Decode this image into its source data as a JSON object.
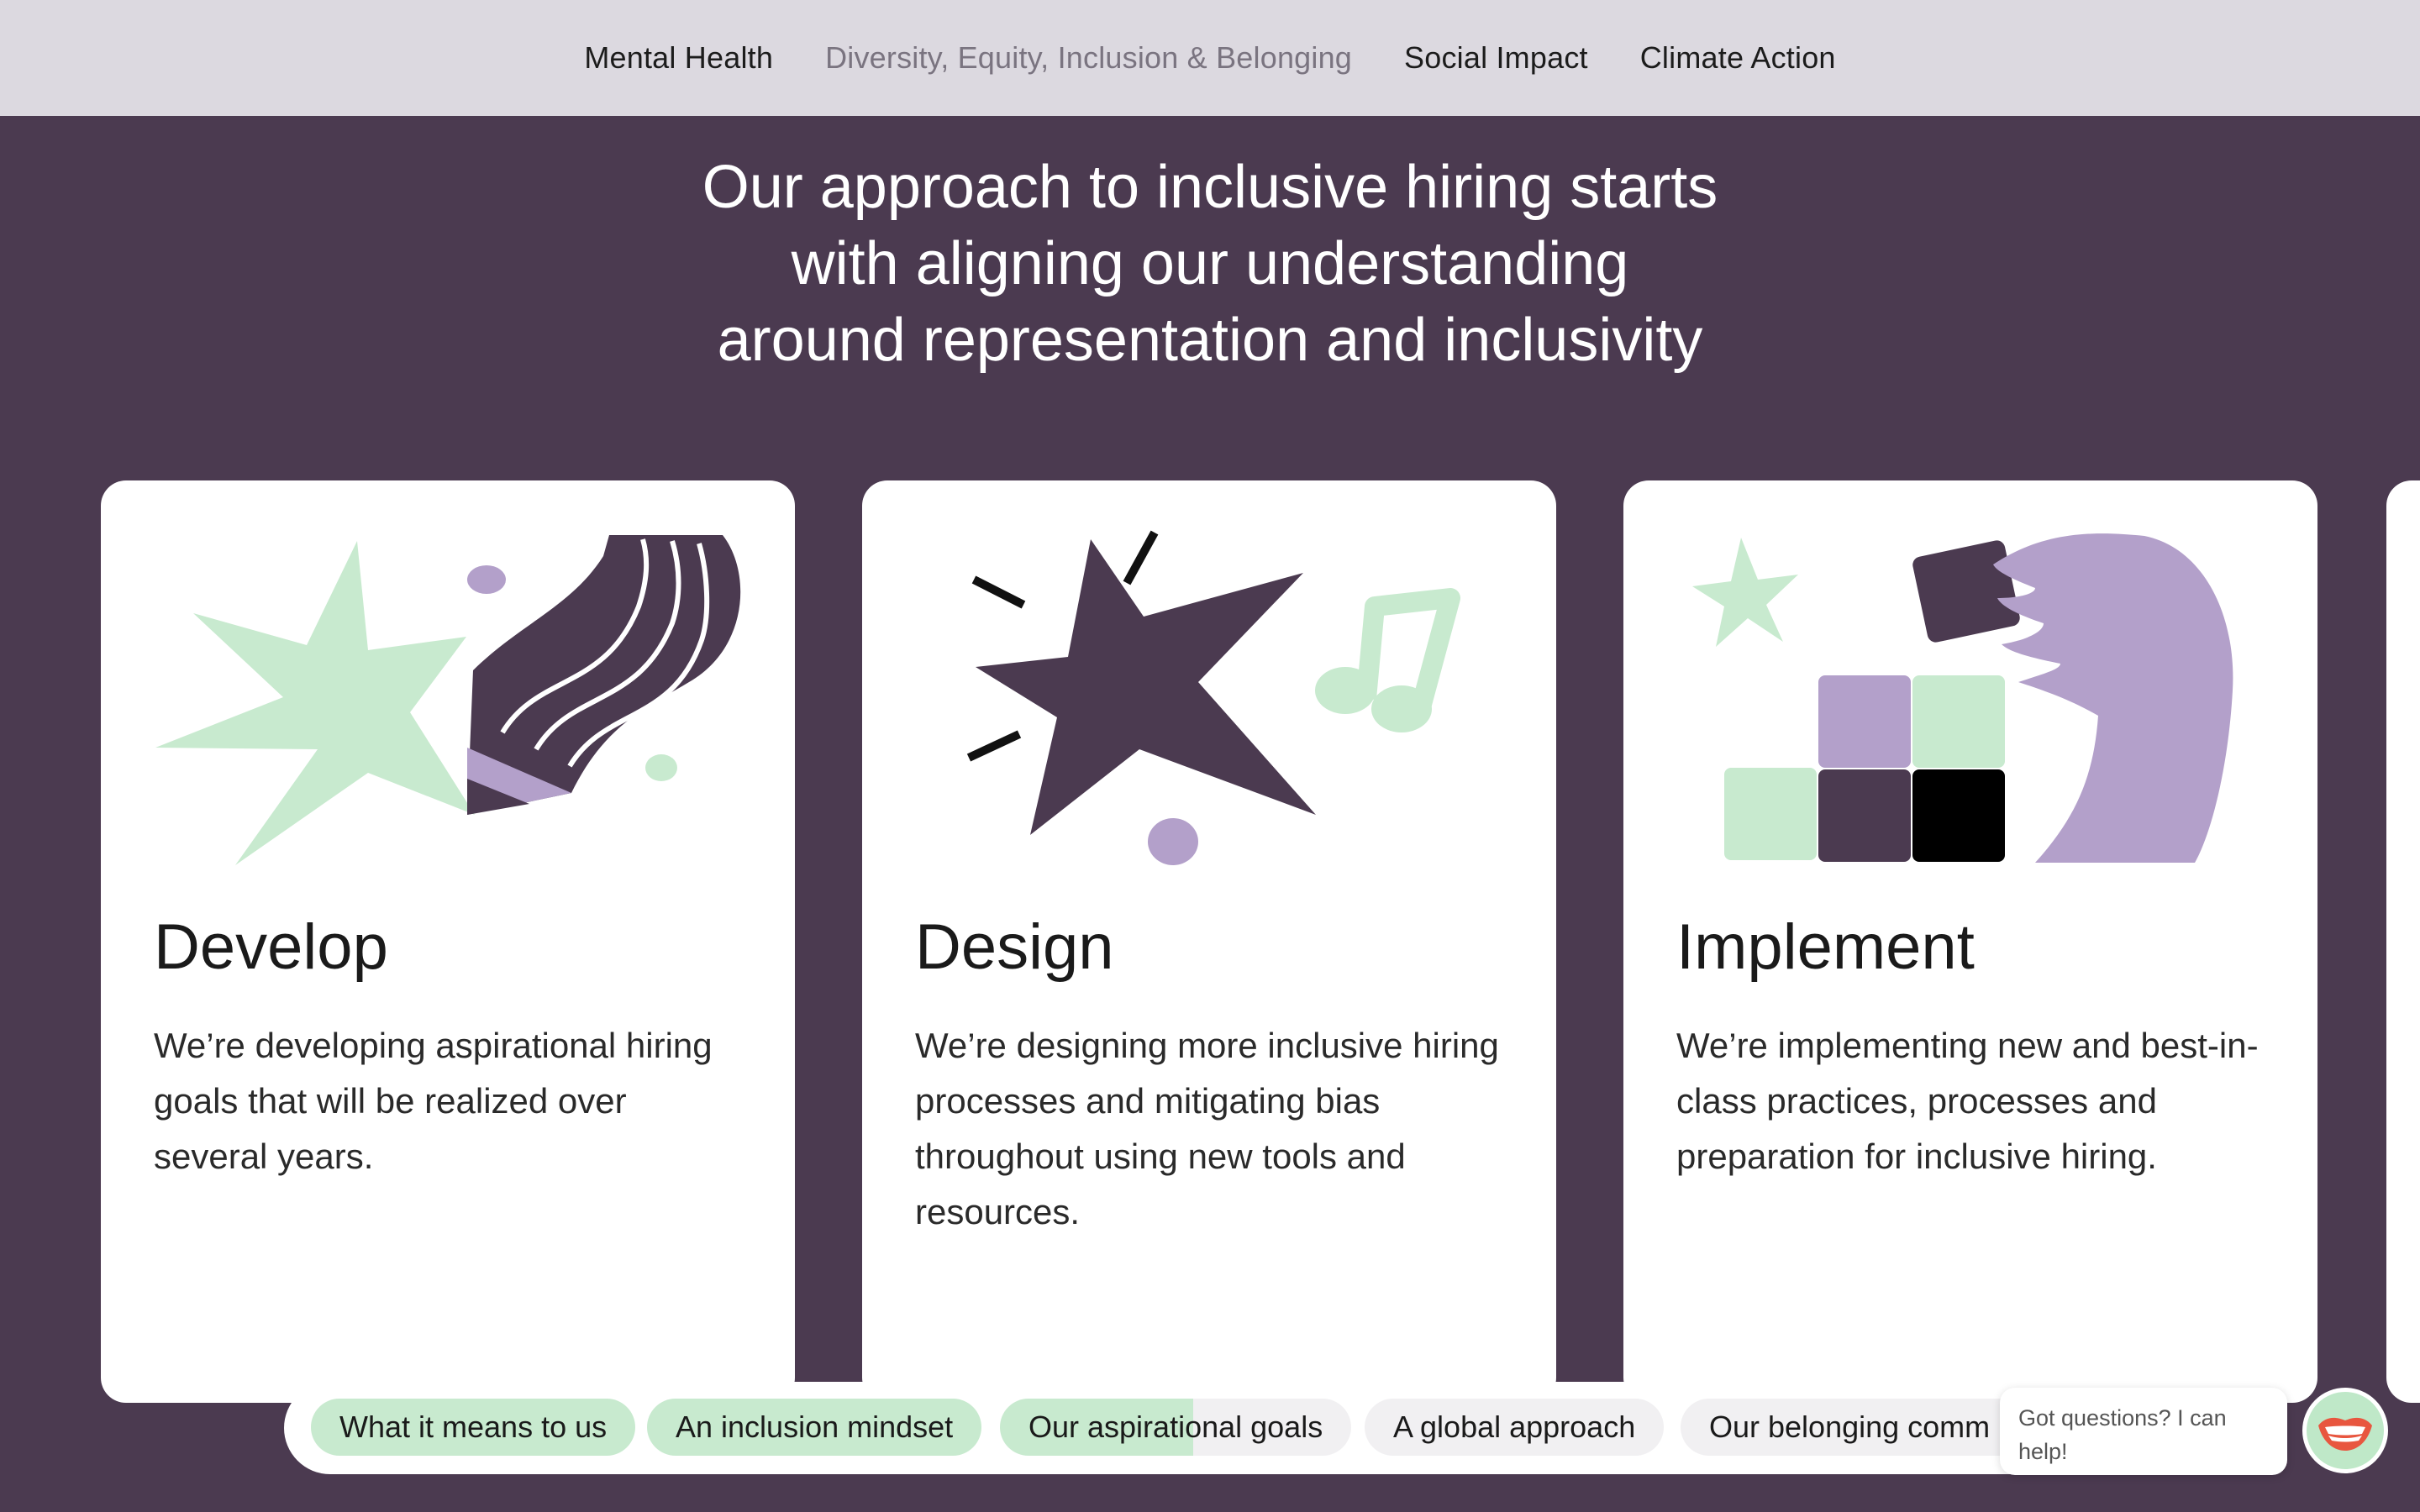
{
  "topnav": {
    "items": [
      {
        "label": "Mental Health"
      },
      {
        "label": "Diversity, Equity, Inclusion & Belonging"
      },
      {
        "label": "Social Impact"
      },
      {
        "label": "Climate Action"
      }
    ]
  },
  "hero": {
    "lines": [
      "Our approach to inclusive hiring starts",
      "with aligning our understanding",
      "around representation and inclusivity"
    ]
  },
  "cards": [
    {
      "title": "Develop",
      "description": "We’re developing aspirational hiring goals that will be realized over several years.",
      "icon": "star-pencil-illustration"
    },
    {
      "title": "Design",
      "description": "We’re designing more inclusive hiring processes and mitigating bias throughout using new tools and resources.",
      "icon": "star-music-note-illustration"
    },
    {
      "title": "Implement",
      "description": "We’re implementing new and best-in-class practices, processes and preparation for inclusive hiring.",
      "icon": "building-blocks-hand-illustration"
    }
  ],
  "subnav": {
    "items": [
      {
        "label": "What it means to us",
        "state": "done"
      },
      {
        "label": "An inclusion mindset",
        "state": "done"
      },
      {
        "label": "Our aspirational goals",
        "state": "current"
      },
      {
        "label": "A global approach",
        "state": "upcoming"
      },
      {
        "label": "Our belonging comm",
        "state": "upcoming"
      }
    ]
  },
  "chat": {
    "text": "Got questions? I can help!",
    "avatar_icon": "smiling-mouth-icon"
  },
  "colors": {
    "background": "#4b3a50",
    "topnav": "#dcd9e0",
    "mint": "#c8eacf",
    "lavender": "#b3a0ca",
    "plum": "#4b3a50"
  }
}
